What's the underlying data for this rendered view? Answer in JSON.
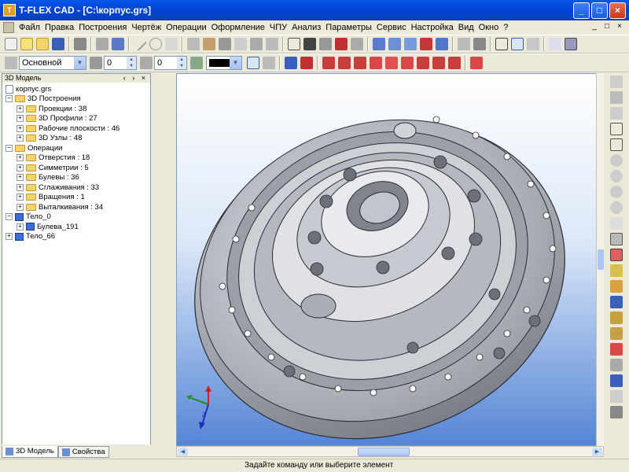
{
  "window": {
    "title": "T-FLEX CAD - [C:\\корпус.grs]",
    "minimize": "_",
    "maximize": "□",
    "close": "×"
  },
  "menu": {
    "items": [
      "Файл",
      "Правка",
      "Построения",
      "Чертёж",
      "Операции",
      "Оформление",
      "ЧПУ",
      "Анализ",
      "Параметры",
      "Сервис",
      "Настройка",
      "Вид",
      "Окно",
      "?"
    ],
    "mdi": [
      "_",
      "□",
      "×"
    ]
  },
  "toolbar2": {
    "style_combo": "Основной",
    "spin1": "0",
    "spin2": "0"
  },
  "panel": {
    "title": "3D Модель",
    "controls": "‹ › ×",
    "root": "корпус.grs",
    "tree": [
      {
        "label": "3D Построения",
        "level": 0,
        "type": "folder",
        "expand": "−"
      },
      {
        "label": "Проекции : 38",
        "level": 1,
        "type": "folder",
        "expand": "+"
      },
      {
        "label": "3D Профили : 27",
        "level": 1,
        "type": "folder",
        "expand": "+"
      },
      {
        "label": "Рабочие плоскости : 46",
        "level": 1,
        "type": "folder",
        "expand": "+"
      },
      {
        "label": "3D Узлы : 48",
        "level": 1,
        "type": "folder",
        "expand": "+"
      },
      {
        "label": "Операции",
        "level": 0,
        "type": "folder",
        "expand": "−"
      },
      {
        "label": "Отверстия : 18",
        "level": 1,
        "type": "folder",
        "expand": "+"
      },
      {
        "label": "Симметрии : 5",
        "level": 1,
        "type": "folder",
        "expand": "+"
      },
      {
        "label": "Булевы : 36",
        "level": 1,
        "type": "folder",
        "expand": "+"
      },
      {
        "label": "Сглаживания : 33",
        "level": 1,
        "type": "folder",
        "expand": "+"
      },
      {
        "label": "Вращения : 1",
        "level": 1,
        "type": "folder",
        "expand": "+"
      },
      {
        "label": "Выталкивания : 34",
        "level": 1,
        "type": "folder",
        "expand": "+"
      },
      {
        "label": "Тело_0",
        "level": 0,
        "type": "body",
        "expand": "−"
      },
      {
        "label": "Булева_191",
        "level": 1,
        "type": "body",
        "expand": "+"
      },
      {
        "label": "Тело_66",
        "level": 0,
        "type": "body",
        "expand": "+"
      }
    ]
  },
  "tabs": [
    "3D Модель",
    "Свойства"
  ],
  "status": {
    "message": "Задайте команду или выберите элемент"
  },
  "axis_labels": {
    "z": "Z"
  },
  "colors": {
    "title_blue": "#0a58e8",
    "part_gray": "#b8bcc2",
    "viewport_bottom": "#5585d5"
  }
}
